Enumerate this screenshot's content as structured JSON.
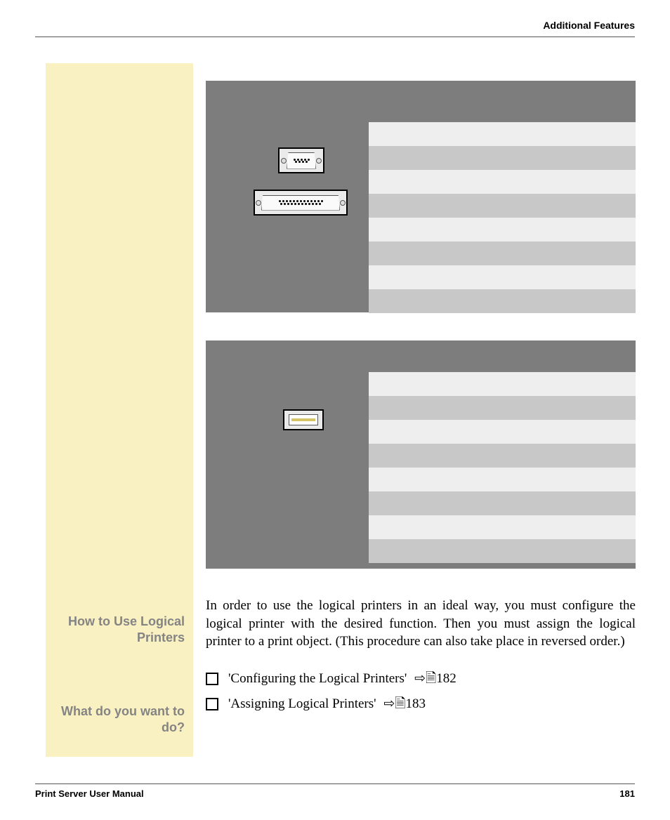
{
  "header": {
    "title": "Additional Features"
  },
  "sidebar": {
    "heading1": "How to Use Logical Printers",
    "heading2": "What do you want to do?"
  },
  "body": {
    "paragraph": "In order to use the logical printers in an ideal way, you must configure the logical printer with the desired function. Then you must assign the logical printer to a print object. (This procedure can also take place in reversed order.)"
  },
  "checklist": {
    "items": [
      {
        "label": "'Configuring the Logical Printers'",
        "page": "182"
      },
      {
        "label": "'Assigning Logical Printers'",
        "page": "183"
      }
    ]
  },
  "footer": {
    "manual": "Print Server User Manual",
    "page": "181"
  }
}
